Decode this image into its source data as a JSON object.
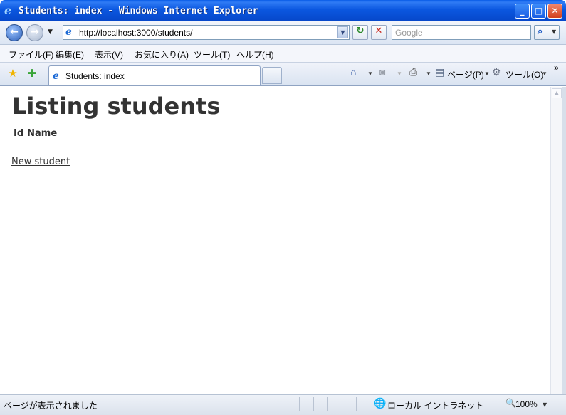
{
  "window": {
    "title": "Students: index - Windows Internet Explorer",
    "minimize": "_",
    "maximize": "□",
    "close": "✕"
  },
  "address_bar": {
    "url": "http://localhost:3000/students/",
    "search_placeholder": "Google"
  },
  "menu": [
    "ファイル(F)",
    "編集(E)",
    "表示(V)",
    "お気に入り(A)",
    "ツール(T)",
    "ヘルプ(H)"
  ],
  "tab": {
    "label": "Students: index"
  },
  "command_bar": {
    "page_label": "ページ(P)",
    "tools_label": "ツール(O)",
    "more": "»"
  },
  "page": {
    "title": "Listing students",
    "columns": [
      "Id",
      "Name"
    ],
    "new_link": "New student"
  },
  "status_bar": {
    "text": "ページが表示されました",
    "zone": "ローカル イントラネット",
    "zoom": "100%"
  },
  "icons": {
    "back": "back-arrow-icon",
    "forward": "forward-arrow-icon",
    "refresh": "refresh-icon",
    "stop": "stop-icon",
    "search": "magnifier-icon",
    "favorites": "star-icon",
    "add_favorite": "add-favorite-icon",
    "home": "home-icon",
    "feeds": "rss-icon",
    "print": "printer-icon",
    "page": "page-icon",
    "tools": "gear-icon",
    "zone": "globe-icon",
    "zoom": "zoom-icon"
  },
  "colors": {
    "titlebar": "#0a5de8",
    "text_heading": "#333333"
  }
}
